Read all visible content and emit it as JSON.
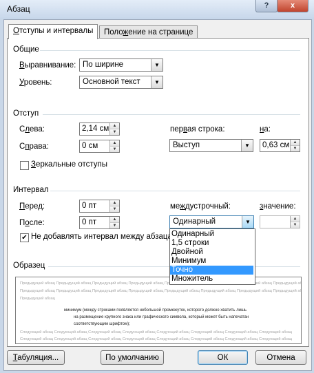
{
  "window": {
    "title": "Абзац",
    "help_label": "?",
    "close_label": "x"
  },
  "tabs": [
    {
      "label": "Отступы и интервалы",
      "underline": "О",
      "rest": "тступы и интервалы"
    },
    {
      "label": "Положение на странице",
      "pre": "Поло",
      "underline": "ж",
      "rest": "ение на странице"
    }
  ],
  "general": {
    "heading": "Общие",
    "alignment_label": {
      "pre": "",
      "u": "В",
      "post": "ыравнивание:"
    },
    "alignment_value": "По ширине",
    "level_label": {
      "pre": "",
      "u": "У",
      "post": "ровень:"
    },
    "level_value": "Основной текст"
  },
  "indent": {
    "heading": "Отступ",
    "left_label": {
      "pre": "С",
      "u": "л",
      "post": "ева:"
    },
    "left_value": "2,14 см",
    "right_label": {
      "pre": "С",
      "u": "п",
      "post": "рава:"
    },
    "right_value": "0 см",
    "first_line_label": {
      "pre": "пер",
      "u": "в",
      "post": "ая строка:"
    },
    "first_line_value": "Выступ",
    "by_label": {
      "pre": "",
      "u": "н",
      "post": "а:"
    },
    "by_value": "0,63 см",
    "mirror_label": {
      "pre": "",
      "u": "З",
      "post": "еркальные отступы"
    },
    "mirror_checked": false
  },
  "spacing": {
    "heading": "Интервал",
    "before_label": {
      "pre": "",
      "u": "П",
      "post": "еред:"
    },
    "before_value": "0 пт",
    "after_label": {
      "pre": "П",
      "u": "о",
      "post": "сле:"
    },
    "after_value": "0 пт",
    "line_label": {
      "pre": "ме",
      "u": "ж",
      "post": "дустрочный:"
    },
    "line_value": "Одинарный",
    "at_label": {
      "pre": "",
      "u": "з",
      "post": "начение:"
    },
    "at_value": "",
    "no_space_label": "Не добавлять интервал между абзацами",
    "no_space_checked": true
  },
  "line_spacing_options": [
    "Одинарный",
    "1,5 строки",
    "Двойной",
    "Минимум",
    "Точно",
    "Множитель"
  ],
  "line_spacing_highlight": "Точно",
  "preview": {
    "heading": "Образец",
    "prev_lines": [
      "Предыдущий абзац Предыдущий абзац Предыдущий абзац Предыдущий абзац Предыдущий абзац Предыдущий абзац Предыдущий абзац Предыдущий абзац",
      "Предыдущий абзац Предыдущий абзац Предыдущий абзац Предыдущий абзац Предыдущий абзац Предыдущий абзац Предыдущий абзац Предыдущий абзац",
      "Предыдущий абзац"
    ],
    "main_lines": [
      "минимум (между строками появляется небольшой промежуток, которого должно хватить лишь",
      "на размещение крупного знака или графического символа, который может быть напечатан",
      "соответствующим шрифтом);"
    ],
    "next_lines": [
      "Следующий абзац Следующий абзац Следующий абзац Следующий абзац Следующий абзац Следующий абзац Следующий абзац Следующий абзац",
      "Следующий абзац Следующий абзац Следующий абзац Следующий абзац Следующий абзац Следующий абзац Следующий абзац Следующий абзац"
    ]
  },
  "buttons": {
    "tabs": {
      "u": "Т",
      "post": "абуляция..."
    },
    "default": {
      "pre": "По ",
      "u": "у",
      "post": "молчанию"
    },
    "ok": "ОК",
    "cancel": "Отмена"
  }
}
